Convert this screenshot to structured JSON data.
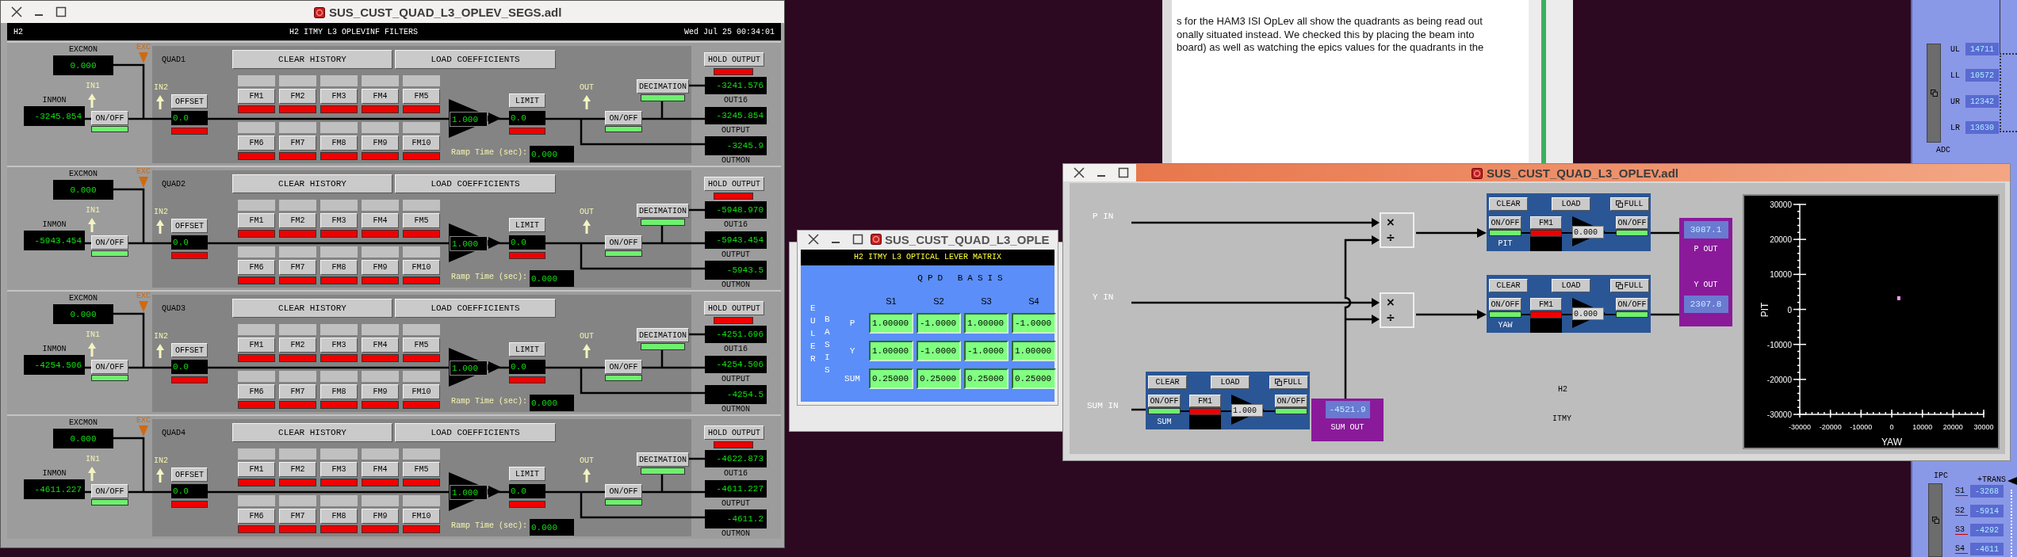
{
  "document": {
    "lines": [
      "s for the HAM3 ISI OpLev all show the quadrants as being read out",
      "onally situated instead. We checked this by placing the beam into",
      "board) as well as watching the epics values for the quadrants in the"
    ]
  },
  "filters_window": {
    "title": "SUS_CUST_QUAD_L3_OPLEV_SEGS.adl",
    "site": "H2",
    "heading": "H2 ITMY L3 OPLEVINF FILTERS",
    "timestamp": "Wed Jul 25 00:34:01",
    "quads": [
      {
        "name": "QUAD1",
        "excmon_label": "EXCMON",
        "excmon": "0.000",
        "exc_label": "EXC",
        "in1_label": "IN1",
        "inmon_label": "INMON",
        "inmon": "-3245.854",
        "input_switch": {
          "label": "ON/OFF",
          "on": true
        },
        "in2_label": "IN2",
        "offset": {
          "label": "OFFSET",
          "value": "0.0",
          "on": false
        },
        "clear_label": "CLEAR HISTORY",
        "load_label": "LOAD COEFFICIENTS",
        "filters": [
          {
            "label": "FM1",
            "on": false
          },
          {
            "label": "FM2",
            "on": false
          },
          {
            "label": "FM3",
            "on": false
          },
          {
            "label": "FM4",
            "on": false
          },
          {
            "label": "FM5",
            "on": false
          },
          {
            "label": "FM6",
            "on": false
          },
          {
            "label": "FM7",
            "on": false
          },
          {
            "label": "FM8",
            "on": false
          },
          {
            "label": "FM9",
            "on": false
          },
          {
            "label": "FM10",
            "on": false
          }
        ],
        "gain": "1.000",
        "limit": {
          "label": "LIMIT",
          "value": "0.0",
          "on": false
        },
        "ramp_label": "Ramp Time (sec):",
        "ramp": "0.000",
        "out_label": "OUT",
        "output_switch": {
          "label": "ON/OFF",
          "on": true
        },
        "decimation": {
          "label": "DECIMATION",
          "on": true
        },
        "hold": {
          "label": "HOLD OUTPUT",
          "on": false
        },
        "out16": "-3241.576",
        "out16_label": "OUT16",
        "output": "-3245.854",
        "output_label": "OUTPUT",
        "outmon": "-3245.9",
        "outmon_label": "OUTMON"
      },
      {
        "name": "QUAD2",
        "excmon_label": "EXCMON",
        "excmon": "0.000",
        "exc_label": "EXC",
        "in1_label": "IN1",
        "inmon_label": "INMON",
        "inmon": "-5943.454",
        "input_switch": {
          "label": "ON/OFF",
          "on": true
        },
        "in2_label": "IN2",
        "offset": {
          "label": "OFFSET",
          "value": "0.0",
          "on": false
        },
        "clear_label": "CLEAR HISTORY",
        "load_label": "LOAD COEFFICIENTS",
        "filters": [
          {
            "label": "FM1",
            "on": false
          },
          {
            "label": "FM2",
            "on": false
          },
          {
            "label": "FM3",
            "on": false
          },
          {
            "label": "FM4",
            "on": false
          },
          {
            "label": "FM5",
            "on": false
          },
          {
            "label": "FM6",
            "on": false
          },
          {
            "label": "FM7",
            "on": false
          },
          {
            "label": "FM8",
            "on": false
          },
          {
            "label": "FM9",
            "on": false
          },
          {
            "label": "FM10",
            "on": false
          }
        ],
        "gain": "1.000",
        "limit": {
          "label": "LIMIT",
          "value": "0.0",
          "on": false
        },
        "ramp_label": "Ramp Time (sec):",
        "ramp": "0.000",
        "out_label": "OUT",
        "output_switch": {
          "label": "ON/OFF",
          "on": true
        },
        "decimation": {
          "label": "DECIMATION",
          "on": true
        },
        "hold": {
          "label": "HOLD OUTPUT",
          "on": false
        },
        "out16": "-5948.970",
        "out16_label": "OUT16",
        "output": "-5943.454",
        "output_label": "OUTPUT",
        "outmon": "-5943.5",
        "outmon_label": "OUTMON"
      },
      {
        "name": "QUAD3",
        "excmon_label": "EXCMON",
        "excmon": "0.000",
        "exc_label": "EXC",
        "in1_label": "IN1",
        "inmon_label": "INMON",
        "inmon": "-4254.506",
        "input_switch": {
          "label": "ON/OFF",
          "on": true
        },
        "in2_label": "IN2",
        "offset": {
          "label": "OFFSET",
          "value": "0.0",
          "on": false
        },
        "clear_label": "CLEAR HISTORY",
        "load_label": "LOAD COEFFICIENTS",
        "filters": [
          {
            "label": "FM1",
            "on": false
          },
          {
            "label": "FM2",
            "on": false
          },
          {
            "label": "FM3",
            "on": false
          },
          {
            "label": "FM4",
            "on": false
          },
          {
            "label": "FM5",
            "on": false
          },
          {
            "label": "FM6",
            "on": false
          },
          {
            "label": "FM7",
            "on": false
          },
          {
            "label": "FM8",
            "on": false
          },
          {
            "label": "FM9",
            "on": false
          },
          {
            "label": "FM10",
            "on": false
          }
        ],
        "gain": "1.000",
        "limit": {
          "label": "LIMIT",
          "value": "0.0",
          "on": false
        },
        "ramp_label": "Ramp Time (sec):",
        "ramp": "0.000",
        "out_label": "OUT",
        "output_switch": {
          "label": "ON/OFF",
          "on": true
        },
        "decimation": {
          "label": "DECIMATION",
          "on": true
        },
        "hold": {
          "label": "HOLD OUTPUT",
          "on": false
        },
        "out16": "-4251.696",
        "out16_label": "OUT16",
        "output": "-4254.506",
        "output_label": "OUTPUT",
        "outmon": "-4254.5",
        "outmon_label": "OUTMON"
      },
      {
        "name": "QUAD4",
        "excmon_label": "EXCMON",
        "excmon": "0.000",
        "exc_label": "EXC",
        "in1_label": "IN1",
        "inmon_label": "INMON",
        "inmon": "-4611.227",
        "input_switch": {
          "label": "ON/OFF",
          "on": true
        },
        "in2_label": "IN2",
        "offset": {
          "label": "OFFSET",
          "value": "0.0",
          "on": false
        },
        "clear_label": "CLEAR HISTORY",
        "load_label": "LOAD COEFFICIENTS",
        "filters": [
          {
            "label": "FM1",
            "on": false
          },
          {
            "label": "FM2",
            "on": false
          },
          {
            "label": "FM3",
            "on": false
          },
          {
            "label": "FM4",
            "on": false
          },
          {
            "label": "FM5",
            "on": false
          },
          {
            "label": "FM6",
            "on": false
          },
          {
            "label": "FM7",
            "on": false
          },
          {
            "label": "FM8",
            "on": false
          },
          {
            "label": "FM9",
            "on": false
          },
          {
            "label": "FM10",
            "on": false
          }
        ],
        "gain": "1.000",
        "limit": {
          "label": "LIMIT",
          "value": "0.0",
          "on": false
        },
        "ramp_label": "Ramp Time (sec):",
        "ramp": "0.000",
        "out_label": "OUT",
        "output_switch": {
          "label": "ON/OFF",
          "on": true
        },
        "decimation": {
          "label": "DECIMATION",
          "on": true
        },
        "hold": {
          "label": "HOLD OUTPUT",
          "on": false
        },
        "out16": "-4622.873",
        "out16_label": "OUT16",
        "output": "-4611.227",
        "output_label": "OUTPUT",
        "outmon": "-4611.2",
        "outmon_label": "OUTMON"
      }
    ]
  },
  "matrix_window": {
    "title": "SUS_CUST_QUAD_L3_OPLE",
    "heading": "H2 ITMY L3 OPTICAL LEVER MATRIX",
    "column_group": "QPD BASIS",
    "row_group_1": "EULER",
    "row_group_2": "BASIS",
    "columns": [
      "S1",
      "S2",
      "S3",
      "S4"
    ],
    "rows": [
      {
        "label": "P",
        "values": [
          "1.00000",
          "-1.0000",
          "1.00000",
          "-1.0000"
        ]
      },
      {
        "label": "Y",
        "values": [
          "1.00000",
          "-1.0000",
          "-1.0000",
          "1.00000"
        ]
      },
      {
        "label": "SUM",
        "values": [
          "0.25000",
          "0.25000",
          "0.25000",
          "0.25000"
        ]
      }
    ]
  },
  "oplev_window": {
    "title": "SUS_CUST_QUAD_L3_OPLEV.adl",
    "inputs": [
      "P IN",
      "Y IN",
      "SUM IN"
    ],
    "dividers": [
      {
        "times": "×",
        "divide": "÷"
      },
      {
        "times": "×",
        "divide": "÷"
      }
    ],
    "modules": [
      {
        "name": "PIT",
        "clear": "CLEAR",
        "load": "LOAD",
        "full": "FULL",
        "input_switch": {
          "label": "ON/OFF",
          "on": true
        },
        "filter": {
          "label": "FM1",
          "on": false
        },
        "gain": "0.000",
        "output_switch": {
          "label": "ON/OFF",
          "on": true
        }
      },
      {
        "name": "YAW",
        "clear": "CLEAR",
        "load": "LOAD",
        "full": "FULL",
        "input_switch": {
          "label": "ON/OFF",
          "on": true
        },
        "filter": {
          "label": "FM1",
          "on": false
        },
        "gain": "0.000",
        "output_switch": {
          "label": "ON/OFF",
          "on": true
        }
      },
      {
        "name": "SUM",
        "clear": "CLEAR",
        "load": "LOAD",
        "full": "FULL",
        "input_switch": {
          "label": "ON/OFF",
          "on": true
        },
        "filter": {
          "label": "FM1",
          "on": false
        },
        "gain": "1.000",
        "output_switch": {
          "label": "ON/OFF",
          "on": true
        }
      }
    ],
    "p_out_label": "P OUT",
    "p_out": "3087.1",
    "y_out_label": "Y OUT",
    "y_out": "2307.8",
    "sum_out_label": "SUM OUT",
    "sum_out": "-4521.9",
    "site": "H2",
    "optic": "ITMY",
    "chart_data": {
      "type": "scatter",
      "xlabel": "YAW",
      "ylabel": "PIT",
      "x": [
        2300
      ],
      "series": [
        {
          "color": "#ff99ff",
          "values": [
            3100
          ]
        }
      ],
      "xlim": [
        -30000,
        30000
      ],
      "ylim": [
        -30000,
        30000
      ],
      "xticks": [
        -30000,
        -20000,
        -10000,
        0,
        10000,
        20000,
        30000
      ],
      "yticks": [
        -30000,
        -20000,
        -10000,
        0,
        10000,
        20000,
        30000
      ]
    }
  },
  "right_panel": {
    "quadrants": [
      {
        "label": "UL",
        "value": "14711"
      },
      {
        "label": "LL",
        "value": "10572"
      },
      {
        "label": "UR",
        "value": "12342"
      },
      {
        "label": "LR",
        "value": "13630"
      }
    ],
    "adc_label": "ADC",
    "ipc_label": "IPC",
    "trans_label": "+TRANS",
    "segments": [
      {
        "label": "S1",
        "value": "-3268"
      },
      {
        "label": "S2",
        "value": "-5914"
      },
      {
        "label": "S3",
        "value": "-4292"
      },
      {
        "label": "S4",
        "value": "-4611"
      }
    ]
  }
}
